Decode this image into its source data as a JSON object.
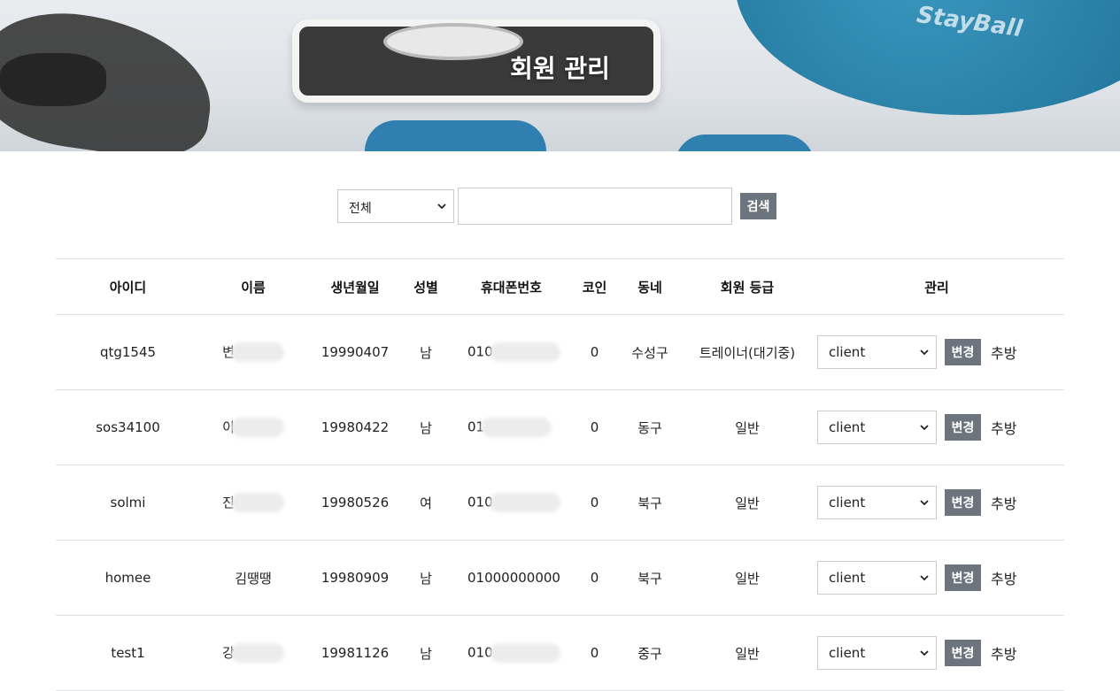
{
  "header": {
    "title": "회원 관리"
  },
  "search": {
    "filter_value": "전체",
    "input_value": "",
    "button_label": "검색"
  },
  "table": {
    "columns": [
      "아이디",
      "이름",
      "생년월일",
      "성별",
      "휴대폰번호",
      "코인",
      "동네",
      "회원 등급",
      "관리"
    ],
    "rows": [
      {
        "id": "qtg1545",
        "name": "변",
        "birth": "19990407",
        "gender": "남",
        "phone": "010",
        "coin": "0",
        "area": "수성구",
        "grade": "트레이너(대기중)",
        "role": "client",
        "change": "변경",
        "kick": "추방"
      },
      {
        "id": "sos34100",
        "name": "이",
        "birth": "19980422",
        "gender": "남",
        "phone": "01",
        "coin": "0",
        "area": "동구",
        "grade": "일반",
        "role": "client",
        "change": "변경",
        "kick": "추방"
      },
      {
        "id": "solmi",
        "name": "진",
        "birth": "19980526",
        "gender": "여",
        "phone": "010",
        "coin": "0",
        "area": "북구",
        "grade": "일반",
        "role": "client",
        "change": "변경",
        "kick": "추방"
      },
      {
        "id": "homee",
        "name": "김땡땡",
        "birth": "19980909",
        "gender": "남",
        "phone": "01000000000",
        "coin": "0",
        "area": "북구",
        "grade": "일반",
        "role": "client",
        "change": "변경",
        "kick": "추방"
      },
      {
        "id": "test1",
        "name": "강",
        "birth": "19981126",
        "gender": "남",
        "phone": "010",
        "coin": "0",
        "area": "중구",
        "grade": "일반",
        "role": "client",
        "change": "변경",
        "kick": "추방"
      }
    ]
  }
}
